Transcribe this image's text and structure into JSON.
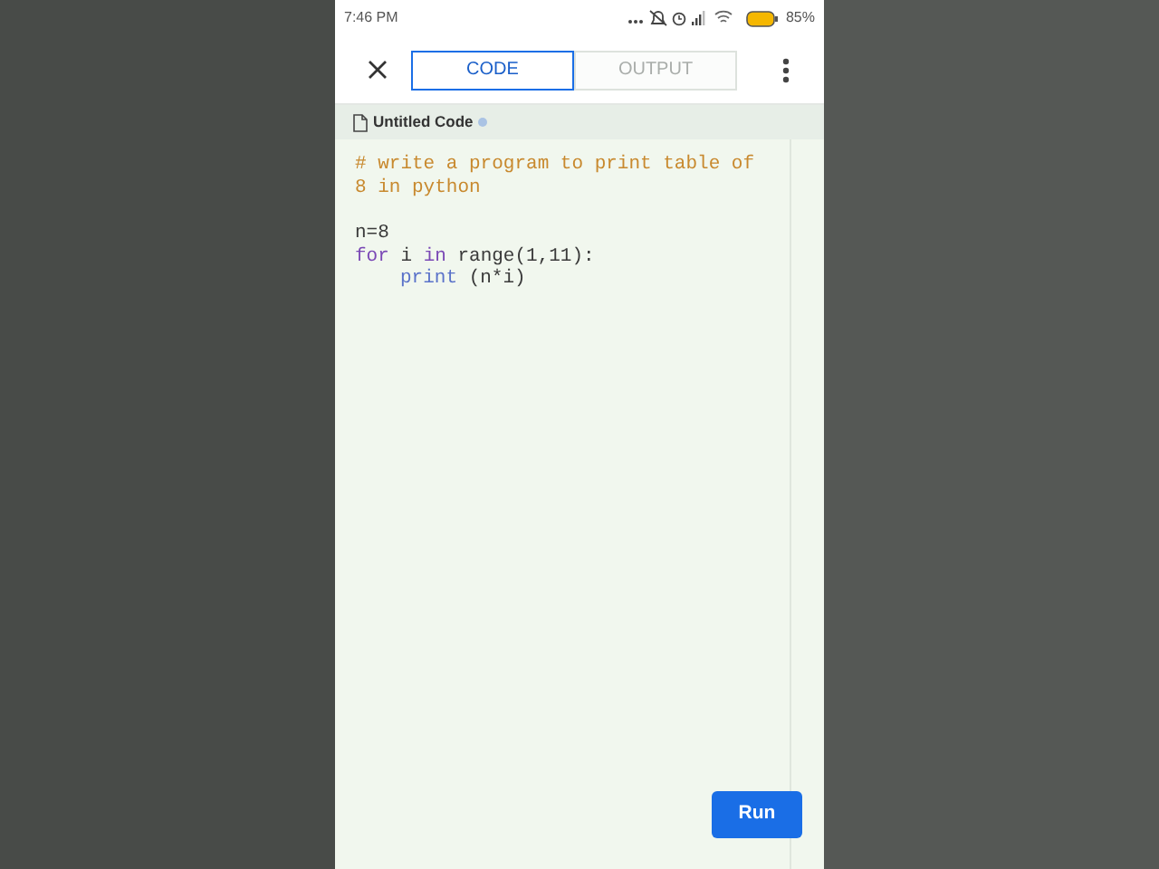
{
  "status_bar": {
    "time": "7:46 PM",
    "battery": "85%"
  },
  "tabs": [
    {
      "label": "CODE",
      "selected": true
    },
    {
      "label": "OUTPUT",
      "selected": false
    }
  ],
  "file": {
    "name": "Untitled Code",
    "unsaved": true
  },
  "code_lines": [
    {
      "blank_before": false,
      "tokens": [
        {
          "kind": "comment",
          "text": "# write a program to print table of"
        }
      ]
    },
    {
      "blank_before": false,
      "tokens": [
        {
          "kind": "comment",
          "text": "8 in python"
        }
      ]
    },
    {
      "blank_before": true,
      "tokens": [
        {
          "kind": "plain",
          "text": "n=8"
        }
      ]
    },
    {
      "blank_before": false,
      "tokens": [
        {
          "kind": "keyword",
          "text": "for"
        },
        {
          "kind": "plain",
          "text": " i "
        },
        {
          "kind": "keyword",
          "text": "in"
        },
        {
          "kind": "plain",
          "text": " range(1,11):"
        }
      ]
    },
    {
      "blank_before": false,
      "indented": true,
      "tokens": [
        {
          "kind": "builtin",
          "text": "print"
        },
        {
          "kind": "plain",
          "text": " (n*i)"
        }
      ]
    }
  ],
  "run_button": {
    "label": "Run"
  }
}
